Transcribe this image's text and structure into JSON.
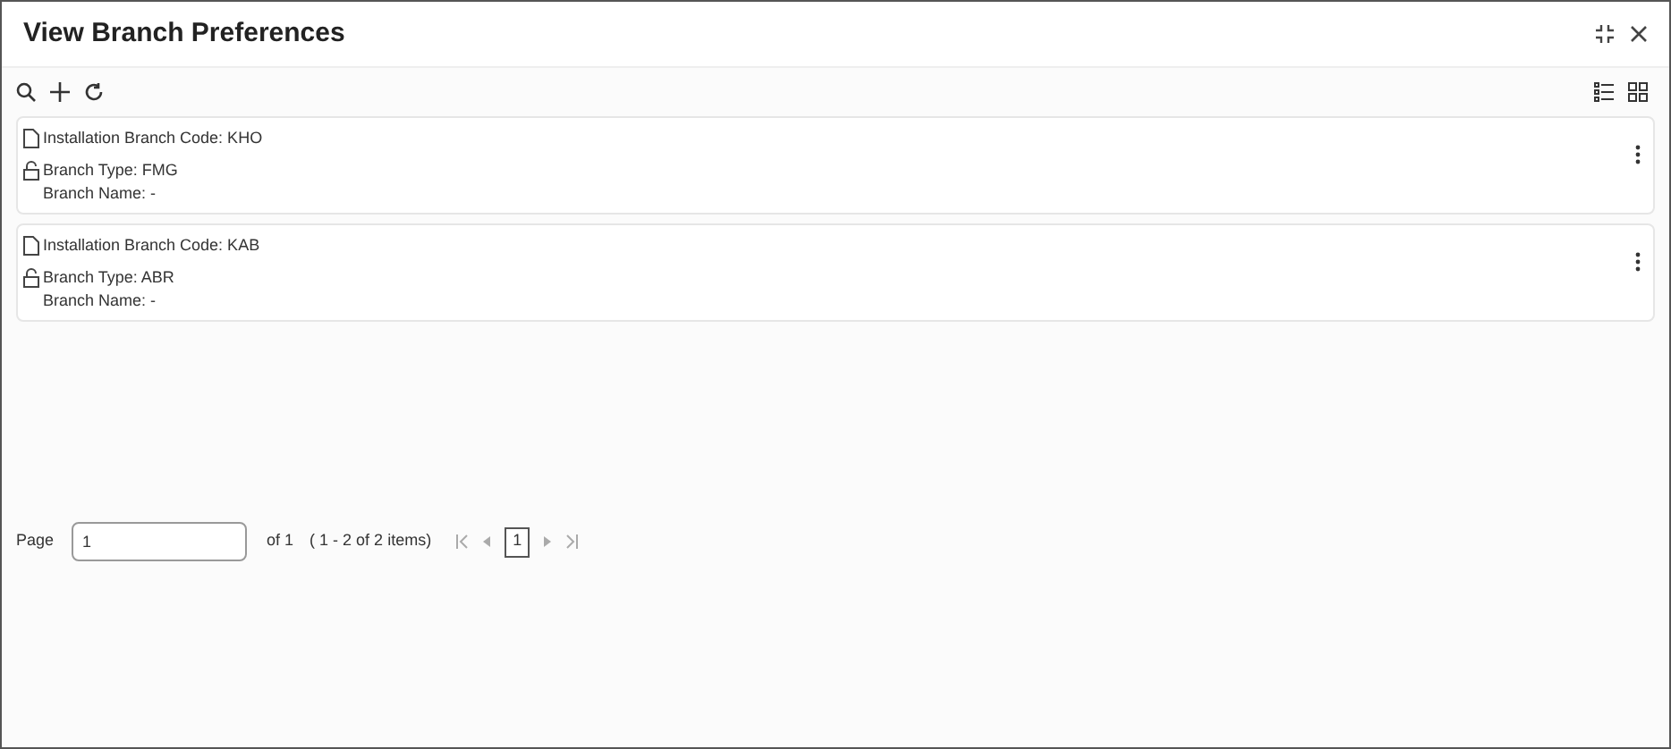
{
  "window": {
    "title": "View Branch Preferences"
  },
  "records": [
    {
      "code": "Installation Branch Code: KHO",
      "type": "Branch Type: FMG",
      "name": "Branch Name: -"
    },
    {
      "code": "Installation Branch Code: KAB",
      "type": "Branch Type: ABR",
      "name": "Branch Name: -"
    }
  ],
  "pager": {
    "label": "Page",
    "value": "1",
    "of": "of 1",
    "summary": "( 1 - 2 of 2 items)",
    "pages": [
      {
        "label": "1",
        "selected": true
      }
    ]
  }
}
